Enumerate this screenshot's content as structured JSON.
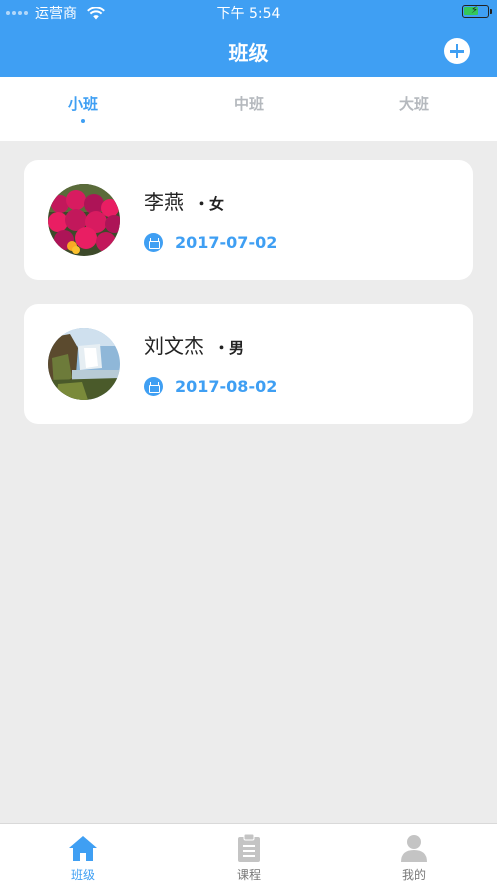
{
  "status_bar": {
    "carrier": "运营商",
    "time": "下午 5:54"
  },
  "header": {
    "title": "班级",
    "add_icon": "plus-circle-icon"
  },
  "tabs": [
    {
      "label": "小班",
      "active": true
    },
    {
      "label": "中班",
      "active": false
    },
    {
      "label": "大班",
      "active": false
    }
  ],
  "students": [
    {
      "name": "李燕",
      "gender": "・女",
      "birth_date": "2017-07-02",
      "avatar": "flowers-photo"
    },
    {
      "name": "刘文杰",
      "gender": "・男",
      "birth_date": "2017-08-02",
      "avatar": "waterfall-photo"
    }
  ],
  "bottom_nav": [
    {
      "label": "班级",
      "icon": "home-icon",
      "active": true
    },
    {
      "label": "课程",
      "icon": "clipboard-icon",
      "active": false
    },
    {
      "label": "我的",
      "icon": "person-icon",
      "active": false
    }
  ],
  "colors": {
    "primary": "#3f9ff3",
    "background": "#ececec",
    "inactive": "#b5b9be"
  }
}
